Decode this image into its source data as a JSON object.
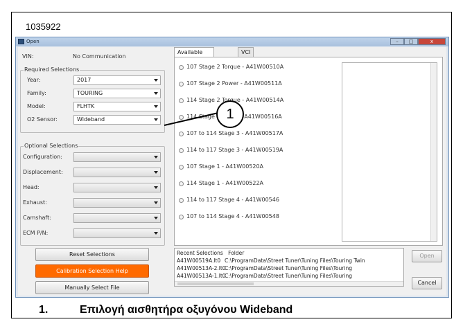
{
  "figure_id": "1035922",
  "window": {
    "title": "Open",
    "min": "–",
    "max": "□",
    "close": "x"
  },
  "vin": {
    "label": "VIN:",
    "value": "No Communication"
  },
  "required": {
    "title": "Required Selections",
    "fields": [
      {
        "label": "Year:",
        "value": "2017"
      },
      {
        "label": "Family:",
        "value": "TOURING"
      },
      {
        "label": "Model:",
        "value": "FLHTK"
      },
      {
        "label": "O2 Sensor:",
        "value": "Wideband"
      }
    ]
  },
  "optional": {
    "title": "Optional Selections",
    "fields": [
      {
        "label": "Configuration:",
        "value": ""
      },
      {
        "label": "Displacement:",
        "value": ""
      },
      {
        "label": "Head:",
        "value": ""
      },
      {
        "label": "Exhaust:",
        "value": ""
      },
      {
        "label": "Camshaft:",
        "value": ""
      },
      {
        "label": "ECM P/N:",
        "value": ""
      }
    ]
  },
  "buttons": {
    "reset": "Reset Selections",
    "help": "Calibration Selection Help",
    "manual": "Manually Select File",
    "open": "Open",
    "cancel": "Cancel"
  },
  "tabs": [
    "Available Calibrations",
    "VCI"
  ],
  "calibrations": [
    "107 Stage 2 Torque - A41W00510A",
    "107 Stage 2 Power - A41W00511A",
    "114 Stage 2 Torque - A41W00514A",
    "114 Stage 2 Power - A41W00516A",
    "107 to 114 Stage 3 - A41W00517A",
    "114 to 117 Stage 3 - A41W00519A",
    "107 Stage 1 - A41W00520A",
    "114 Stage 1 - A41W00522A",
    "114 to 117 Stage 4 - A41W00546",
    "107 to 114 Stage 4 - A41W00548"
  ],
  "recent": {
    "headers": [
      "Recent Selections",
      "Folder"
    ],
    "rows": [
      [
        "A41W00519A.lt0",
        "C:\\ProgramData\\Street Tuner\\Tuning Files\\Touring Twin"
      ],
      [
        "A41W00513A-2.lt0",
        "C:\\ProgramData\\Street Tuner\\Tuning Files\\Touring"
      ],
      [
        "A41W00513A-1.lt0",
        "C:\\ProgramData\\Street Tuner\\Tuning Files\\Touring"
      ]
    ]
  },
  "callout": {
    "number": "1"
  },
  "caption": {
    "number": "1.",
    "text": "Επιλογή αισθητήρα οξυγόνου Wideband"
  },
  "colors": {
    "accent_orange": "#ff6a00",
    "titlebar": "#bfd3ea"
  }
}
